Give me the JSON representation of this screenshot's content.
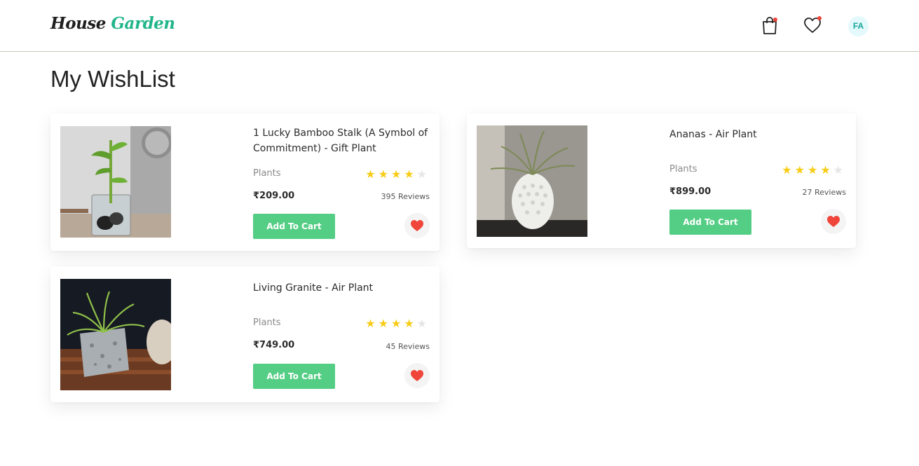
{
  "header": {
    "logo_word1": "House",
    "logo_word2": "Garden",
    "avatar_initials": "FA",
    "icons": [
      "shopping-bag-icon",
      "heart-icon"
    ]
  },
  "page": {
    "title": "My WishList"
  },
  "colors": {
    "brand": "#21b58a",
    "add_to_cart": "#55ce85",
    "star": "#f8cc16",
    "heart": "#f0453a",
    "notification_dot": "#f0453a"
  },
  "wishlist": [
    {
      "name": "1 Lucky Bamboo Stalk (A Symbol of Commitment) - Gift Plant",
      "category": "Plants",
      "rating": 4,
      "rating_max": 5,
      "price": "₹209.00",
      "reviews": "395 Reviews",
      "button": "Add To Cart"
    },
    {
      "name": "Ananas - Air Plant",
      "category": "Plants",
      "rating": 4,
      "rating_max": 5,
      "price": "₹899.00",
      "reviews": "27 Reviews",
      "button": "Add To Cart"
    },
    {
      "name": "Living Granite - Air Plant",
      "category": "Plants",
      "rating": 4,
      "rating_max": 5,
      "price": "₹749.00",
      "reviews": "45 Reviews",
      "button": "Add To Cart"
    }
  ]
}
